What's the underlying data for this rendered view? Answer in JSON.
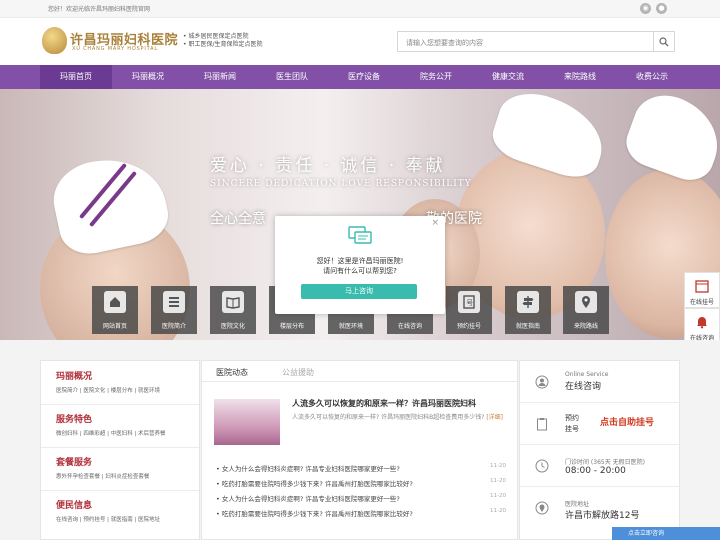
{
  "topbar": {
    "welcome": "您好！欢迎光临许昌玛丽妇科医院官网",
    "icons": [
      "weibo-icon",
      "wechat-icon"
    ]
  },
  "header": {
    "logo_cn": "许昌玛丽妇科医院",
    "logo_en": "XU CHANG MARY HOSPITAL",
    "slogan_1": "• 城乡居民医保定点医院",
    "slogan_2": "• 职工医保/生育保险定点医院",
    "search_placeholder": "请输入您想要查询的内容"
  },
  "nav": {
    "items": [
      "玛丽首页",
      "玛丽概况",
      "玛丽新闻",
      "医生团队",
      "医疗设备",
      "院务公开",
      "健康交流",
      "来院路线",
      "收费公示"
    ],
    "active": "玛丽首页"
  },
  "banner": {
    "title": "爱心 · 责任 · 诚信 · 奉献",
    "title_en": "SINCERE DEDICATION LOVE RESPONSIBILITY",
    "subtitle": "全心全意",
    "subtitle_tail": "敬的医院",
    "quick_links": [
      "网站首页",
      "医院简介",
      "医院文化",
      "楼层分布",
      "就医环境",
      "在线咨询",
      "预约挂号",
      "就医指南",
      "来院路线"
    ]
  },
  "popup": {
    "line1": "您好！这里是许昌玛丽医院!",
    "line2": "请问有什么可以帮到您?",
    "button": "马上咨询",
    "close": "×"
  },
  "side_float": {
    "items": [
      "在线挂号",
      "在线咨询",
      "",
      "口碑"
    ]
  },
  "left_column": {
    "sections": [
      {
        "title": "玛丽概况",
        "links": "医院简介 | 医院文化 | 楼层分布 | 就医环境"
      },
      {
        "title": "服务特色",
        "links": "微创妇科 | 四维彩超 | 中医妇科 | 术后营养餐"
      },
      {
        "title": "套餐服务",
        "links": "惠外怀孕检查套餐 | 妇科炎症检查套餐"
      },
      {
        "title": "便民信息",
        "links": "在线咨询 | 预约挂号 | 就医指南 | 医院地址"
      }
    ]
  },
  "mid_column": {
    "tabs": [
      "医院动态",
      "公益援助"
    ],
    "headline": "人流多久可以恢复的和原来一样？许昌玛丽医院妇科",
    "headline_desc": "人流多久可以恢复的和原来一样? 许昌玛丽医院妇科B超检查费用多少钱?",
    "more": "[详细]",
    "news": [
      {
        "title": "女人为什么会得妇科炎症啊? 许昌专业妇科医院哪家更好一些?",
        "date": "11-20"
      },
      {
        "title": "吃药打胎需要住院吗得多少钱下来? 许昌禹州打胎医院哪家比较好?",
        "date": "11-20"
      },
      {
        "title": "女人为什么会得妇科炎症啊? 许昌专业妇科医院哪家更好一些?",
        "date": "11-20"
      },
      {
        "title": "吃药打胎需要住院吗得多少钱下来? 许昌禹州打胎医院哪家比较好?",
        "date": "11-20"
      }
    ]
  },
  "right_column": {
    "online_en": "Online Service",
    "online_cn": "在线咨询",
    "appoint_label_1": "预约",
    "appoint_label_2": "挂号",
    "appoint_cta": "点击自助挂号",
    "hours_label": "门诊时间 (365天 无假日医院)",
    "hours_value": "08:00 - 20:00",
    "address_label": "医院地址",
    "address_value": "许昌市解放路12号"
  },
  "float_bar": {
    "label": "点击立即咨询"
  },
  "colors": {
    "nav": "#8251a7",
    "nav_active": "#6b3b93",
    "accent_red": "#b0303a",
    "cta_teal": "#39bcae"
  }
}
